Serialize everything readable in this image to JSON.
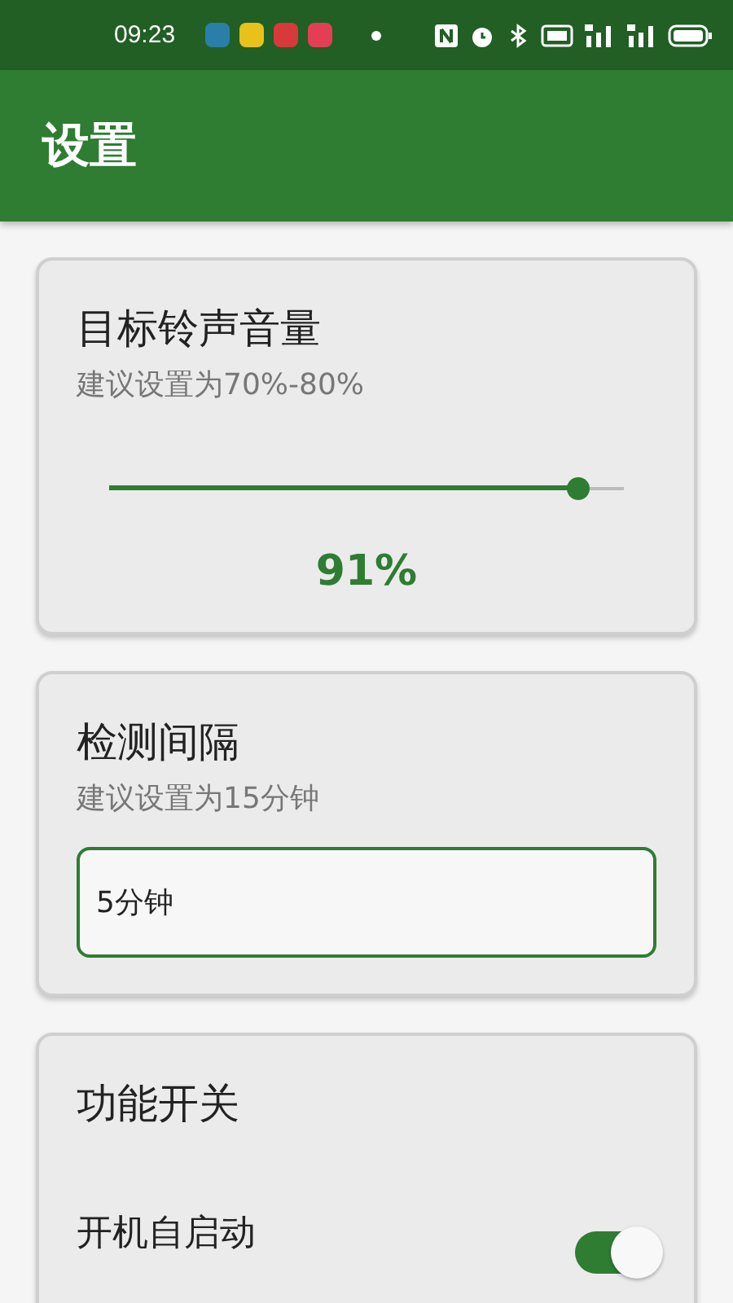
{
  "status_bar": {
    "time": "09:23"
  },
  "app_bar": {
    "title": "设置"
  },
  "volume_card": {
    "title": "目标铃声音量",
    "hint": "建议设置为70%-80%",
    "level": 0.91,
    "reading": "91%"
  },
  "interval_card": {
    "title": "检测间隔",
    "hint": "建议设置为15分钟",
    "value": "5分钟"
  },
  "switch_card": {
    "title": "功能开关",
    "items": [
      {
        "label": "开机自启动",
        "on": true
      }
    ]
  }
}
